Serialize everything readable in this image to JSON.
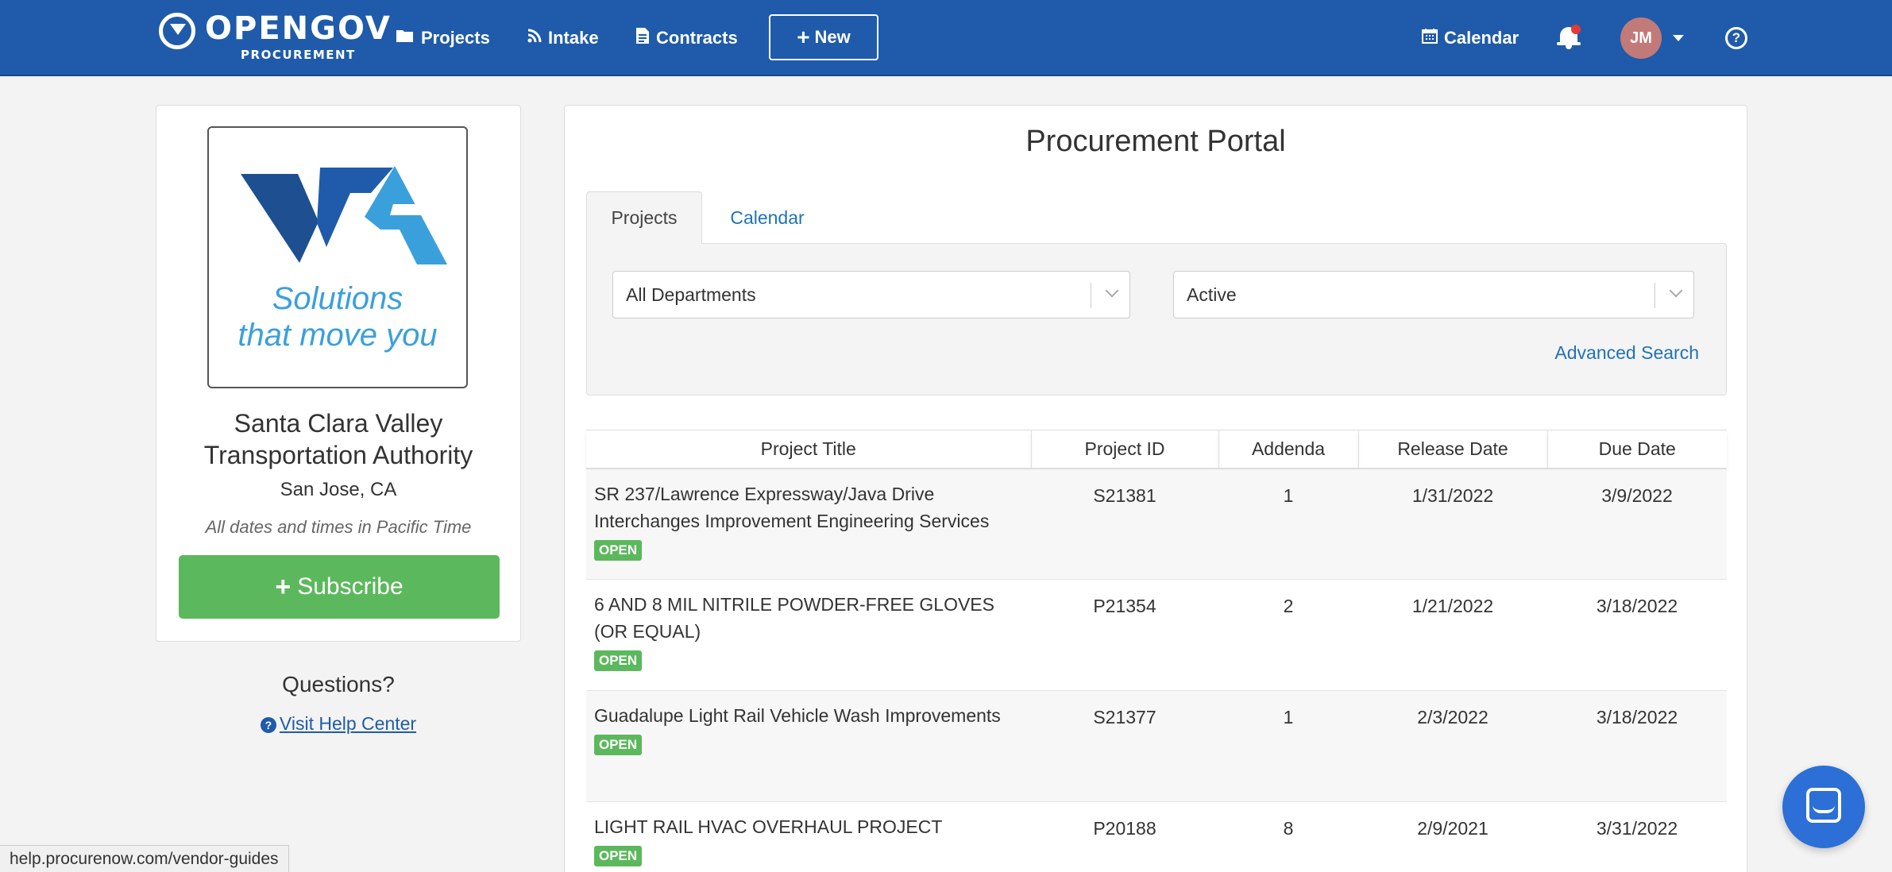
{
  "navbar": {
    "brand_main": "OPENGOV",
    "brand_sub": "PROCUREMENT",
    "links": [
      {
        "label": "Projects",
        "icon": "folder-icon"
      },
      {
        "label": "Intake",
        "icon": "rss-icon"
      },
      {
        "label": "Contracts",
        "icon": "file-icon"
      }
    ],
    "new_label": "New",
    "calendar_label": "Calendar",
    "user_initials": "JM",
    "colors": {
      "bar": "#1f5baa",
      "avatar": "#c27a78",
      "notification": "#e53935"
    }
  },
  "org": {
    "tagline_line1": "Solutions",
    "tagline_line2": "that move you",
    "logo_text": "VTA",
    "name_line1": "Santa Clara Valley",
    "name_line2": "Transportation Authority",
    "location": "San Jose, CA",
    "timezone_note": "All dates and times in Pacific Time",
    "subscribe_label": "Subscribe",
    "questions_label": "Questions?",
    "help_link_label": "Visit Help Center"
  },
  "portal": {
    "title": "Procurement Portal",
    "tabs": [
      {
        "label": "Projects",
        "active": true
      },
      {
        "label": "Calendar",
        "active": false
      }
    ],
    "filters": {
      "department": "All Departments",
      "status": "Active"
    },
    "advanced_search_label": "Advanced Search",
    "table": {
      "headers": [
        "Project Title",
        "Project ID",
        "Addenda",
        "Release Date",
        "Due Date"
      ],
      "rows": [
        {
          "title": "SR 237/Lawrence Expressway/Java Drive Interchanges Improvement Engineering Services",
          "status": "OPEN",
          "id": "S21381",
          "addenda": "1",
          "release": "1/31/2022",
          "due": "3/9/2022"
        },
        {
          "title": "6 AND 8 MIL NITRILE POWDER-FREE GLOVES (OR EQUAL)",
          "status": "OPEN",
          "id": "P21354",
          "addenda": "2",
          "release": "1/21/2022",
          "due": "3/18/2022"
        },
        {
          "title": "Guadalupe Light Rail Vehicle Wash Improvements",
          "status": "OPEN",
          "id": "S21377",
          "addenda": "1",
          "release": "2/3/2022",
          "due": "3/18/2022"
        },
        {
          "title": "LIGHT RAIL HVAC OVERHAUL PROJECT",
          "status": "OPEN",
          "id": "P20188",
          "addenda": "8",
          "release": "2/9/2021",
          "due": "3/31/2022"
        }
      ]
    }
  },
  "statusbar": {
    "url": "help.procurenow.com/vendor-guides"
  },
  "colors": {
    "subscribe": "#5cb85c",
    "badge_open": "#5cb85c",
    "link": "#1f73b7",
    "chat": "#2c6fd6"
  }
}
